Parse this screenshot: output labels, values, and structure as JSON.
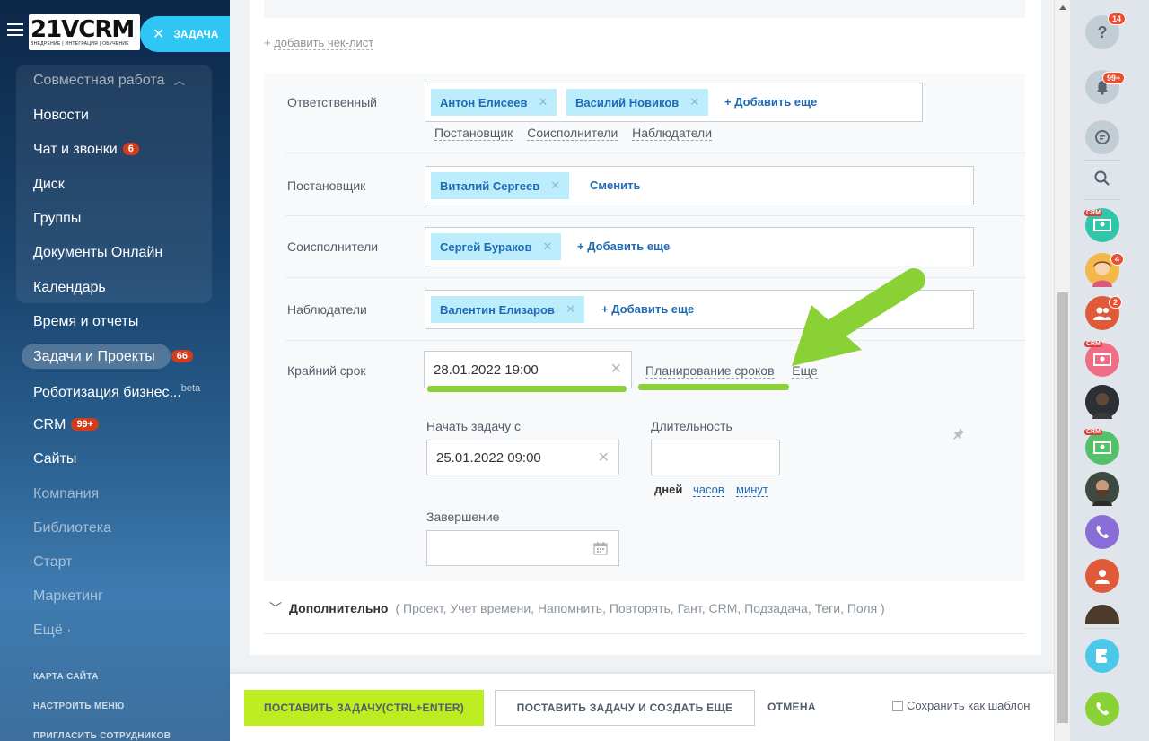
{
  "header": {
    "logo_text": "21VCRM",
    "logo_sub": "ВНЕДРЕНИЕ | ИНТЕГРАЦИЯ | ОБУЧЕНИЕ",
    "task_pill": "ЗАДАЧА"
  },
  "sidebar": {
    "group_title": "Совместная работа",
    "items": [
      {
        "label": "Новости"
      },
      {
        "label": "Чат и звонки",
        "badge": "6"
      },
      {
        "label": "Диск"
      },
      {
        "label": "Группы"
      },
      {
        "label": "Документы Онлайн"
      },
      {
        "label": "Календарь"
      },
      {
        "label": "Время и отчеты"
      },
      {
        "label": "Задачи и Проекты",
        "badge": "66"
      },
      {
        "label": "Роботизация бизнес...",
        "tag": "beta"
      },
      {
        "label": "CRM",
        "badge": "99+"
      },
      {
        "label": "Сайты"
      },
      {
        "label": "Компания"
      },
      {
        "label": "Библиотека"
      },
      {
        "label": "Старт"
      },
      {
        "label": "Маркетинг"
      },
      {
        "label": "Ещё ·"
      }
    ],
    "links": [
      "КАРТА САЙТА",
      "НАСТРОИТЬ МЕНЮ",
      "ПРИГЛАСИТЬ СОТРУДНИКОВ"
    ]
  },
  "form": {
    "add_checklist": "добавить чек-лист",
    "responsible": {
      "label": "Ответственный",
      "users": [
        "Антон Елисеев",
        "Василий Новиков"
      ],
      "add": "Добавить еще",
      "roles": [
        "Постановщик",
        "Соисполнители",
        "Наблюдатели"
      ]
    },
    "creator": {
      "label": "Постановщик",
      "users": [
        "Виталий Сергеев"
      ],
      "change": "Сменить"
    },
    "accomplices": {
      "label": "Соисполнители",
      "users": [
        "Сергей Бураков"
      ],
      "add": "Добавить еще"
    },
    "auditors": {
      "label": "Наблюдатели",
      "users": [
        "Валентин Елизаров"
      ],
      "add": "Добавить еще"
    },
    "deadline": {
      "label": "Крайний срок",
      "value": "28.01.2022 19:00",
      "planning": "Планирование сроков",
      "more": "Еще"
    },
    "start": {
      "label": "Начать задачу с",
      "value": "25.01.2022 09:00"
    },
    "duration": {
      "label": "Длительность",
      "value": "",
      "units": [
        "дней",
        "часов",
        "минут"
      ]
    },
    "end": {
      "label": "Завершение",
      "value": ""
    },
    "additional": {
      "title": "Дополнительно",
      "options": "( Проект,  Учет времени,  Напомнить,  Повторять,  Гант,  CRM,  Подзадача,  Теги,  Поля )"
    }
  },
  "footer": {
    "submit": "ПОСТАВИТЬ ЗАДАЧУ(CTRL+ENTER)",
    "submit_more": "ПОСТАВИТЬ ЗАДАЧУ И СОЗДАТЬ ЕЩЕ",
    "cancel": "ОТМЕНА",
    "save_template": "Сохранить как шаблон"
  },
  "rail": {
    "help_badge": "14",
    "notify_badge": "99+",
    "crm_tag": "CRM",
    "avatar1_badge": "4",
    "group_badge": "2"
  },
  "colors": {
    "accent": "#2fc6f6",
    "chip_bg": "#bcedfc",
    "primary_button": "#bbed21",
    "annotation_green": "#8ad136",
    "badge_red": "#d33b1d"
  }
}
